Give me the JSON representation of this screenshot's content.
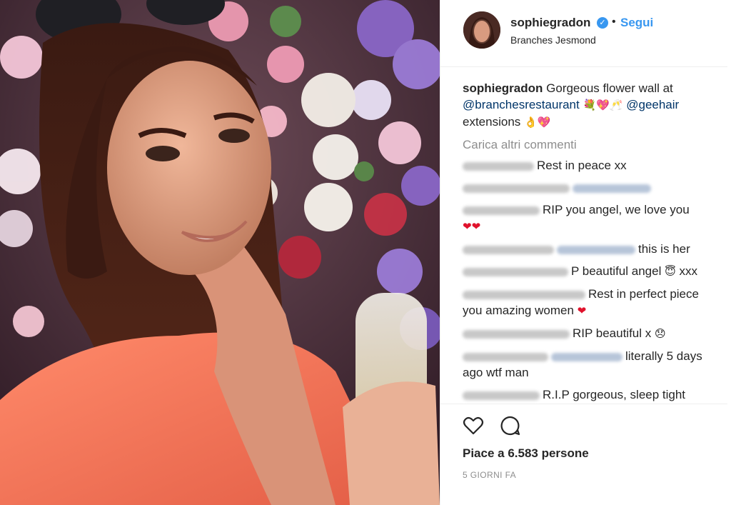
{
  "post": {
    "photo_alt": "Selfie in front of flower wall"
  },
  "header": {
    "username": "sophiegradon",
    "verified_icon": "verified-badge-icon",
    "dot": "•",
    "follow_label": "Segui",
    "location": "Branches Jesmond"
  },
  "caption": {
    "username": "sophiegradon",
    "text_1": "Gorgeous flower wall at",
    "mention_1": "@branchesrestaurant",
    "emojis_1": "💐💖🥂",
    "mention_2": "@geehair",
    "text_2": "extensions",
    "emojis_2": "👌💖"
  },
  "load_more_label": "Carica altri commenti",
  "comments": [
    {
      "text": "Rest in peace xx"
    },
    {
      "text": ""
    },
    {
      "text": "RIP you angel, we love you",
      "emoji": "❤❤"
    },
    {
      "text": "this is her"
    },
    {
      "text": "P beautiful angel",
      "emoji": "😇",
      "tail": "xxx"
    },
    {
      "text": "Rest in perfect piece you amazing women",
      "emoji": "❤"
    },
    {
      "text": "RIP beautiful x",
      "emoji": "😞"
    },
    {
      "text": "literally 5 days ago wtf man"
    },
    {
      "text": "R.I.P gorgeous, sleep tight"
    }
  ],
  "actions": {
    "like_icon": "heart-outline-icon",
    "comment_icon": "comment-bubble-icon"
  },
  "likes_text": "Piace a 6.583 persone",
  "time_text": "5 GIORNI FA",
  "colors": {
    "link": "#3897f0",
    "mention": "#003569",
    "muted": "#8e8e8e",
    "heart": "#e0122c"
  }
}
